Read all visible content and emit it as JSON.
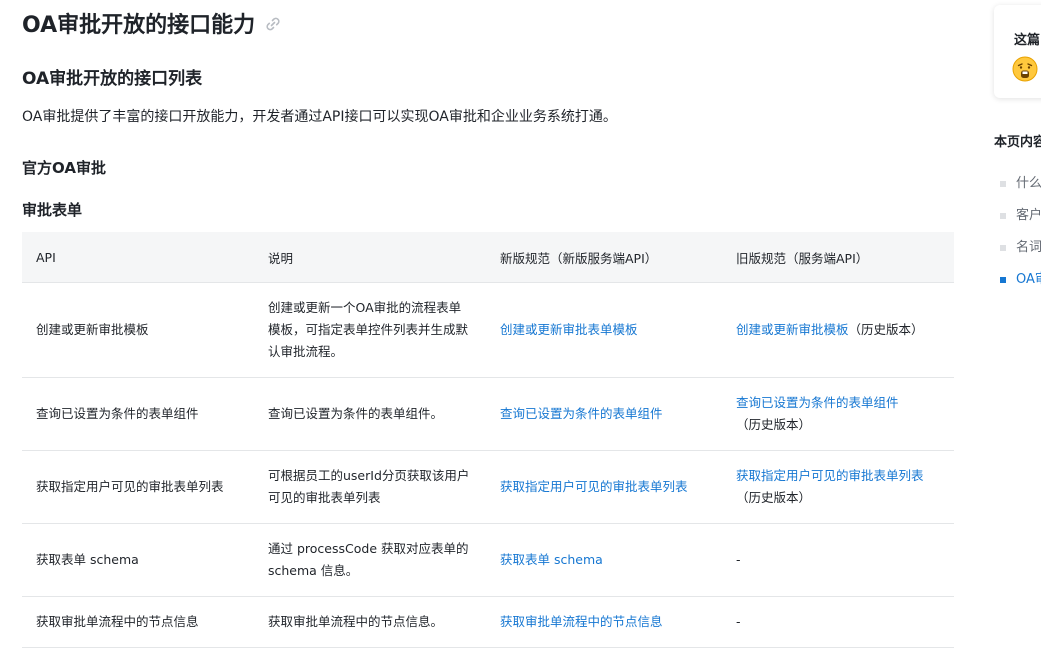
{
  "page": {
    "title": "OA审批开放的接口能力",
    "section_title": "OA审批开放的接口列表",
    "intro": "OA审批提供了丰富的接口开放能力，开发者通过API接口可以实现OA审批和企业业务系统打通。",
    "subsection": "官方OA审批",
    "table_heading": "审批表单"
  },
  "table": {
    "headers": [
      "API",
      "说明",
      "新版规范（新版服务端API）",
      "旧版规范（服务端API）"
    ],
    "rows": [
      {
        "api": "创建或更新审批模板",
        "desc": "创建或更新一个OA审批的流程表单模板，可指定表单控件列表并生成默认审批流程。",
        "new_link": "创建或更新审批表单模板",
        "old_link": "创建或更新审批模板",
        "old_suffix": "（历史版本）"
      },
      {
        "api": "查询已设置为条件的表单组件",
        "desc": "查询已设置为条件的表单组件。",
        "new_link": "查询已设置为条件的表单组件",
        "old_link": "查询已设置为条件的表单组件",
        "old_suffix": "（历史版本）"
      },
      {
        "api": "获取指定用户可见的审批表单列表",
        "desc": "可根据员工的userId分页获取该用户可见的审批表单列表",
        "new_link": "获取指定用户可见的审批表单列表",
        "old_link": "获取指定用户可见的审批表单列表",
        "old_suffix": "（历史版本）"
      },
      {
        "api": "获取表单 schema",
        "desc": "通过 processCode 获取对应表单的 schema 信息。",
        "new_link": "获取表单 schema",
        "old_link": "",
        "old_suffix": "-"
      },
      {
        "api": "获取审批单流程中的节点信息",
        "desc": "获取审批单流程中的节点信息。",
        "new_link": "获取审批单流程中的节点信息",
        "old_link": "",
        "old_suffix": "-"
      }
    ]
  },
  "sidebar": {
    "card_title": "这篇",
    "toc_title": "本页内容",
    "toc_items": [
      "什么",
      "客户",
      "名词",
      "OA审"
    ],
    "active_index": 3
  },
  "colors": {
    "link": "#1677d2",
    "header_bg": "#f5f6f7",
    "border": "#e4e6e8"
  },
  "icons": {
    "title_anchor": "link-icon",
    "feedback": "shocked-emoji-icon"
  }
}
